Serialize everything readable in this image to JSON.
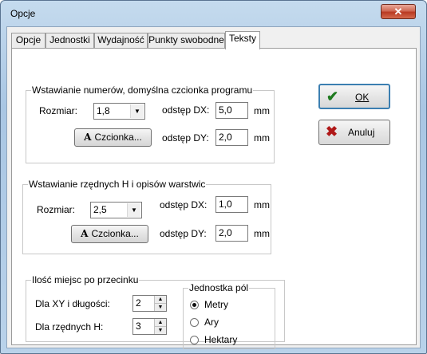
{
  "window": {
    "title": "Opcje",
    "close_glyph": "✕"
  },
  "tabs": [
    {
      "label": "Opcje"
    },
    {
      "label": "Jednostki"
    },
    {
      "label": "Wydajność"
    },
    {
      "label": "Punkty swobodne"
    },
    {
      "label": "Teksty"
    }
  ],
  "active_tab": "Teksty",
  "group_numbers": {
    "title": "Wstawianie numerów, domyślna czcionka programu",
    "size_label": "Rozmiar:",
    "size_value": "1,8",
    "font_button": "Czcionka...",
    "font_button_icon": "A",
    "dx_label": "odstęp DX:",
    "dx_value": "5,0",
    "dx_unit": "mm",
    "dy_label": "odstęp DY:",
    "dy_value": "2,0",
    "dy_unit": "mm"
  },
  "group_heights": {
    "title": "Wstawianie rzędnych H i opisów warstwic",
    "size_label": "Rozmiar:",
    "size_value": "2,5",
    "font_button": "Czcionka...",
    "font_button_icon": "A",
    "dx_label": "odstęp DX:",
    "dx_value": "1,0",
    "dx_unit": "mm",
    "dy_label": "odstęp DY:",
    "dy_value": "2,0",
    "dy_unit": "mm"
  },
  "group_decimals": {
    "title": "Ilość miejsc po przecinku",
    "xy_label": "Dla XY i długości:",
    "xy_value": "2",
    "h_label": "Dla rzędnych H:",
    "h_value": "3"
  },
  "group_area_unit": {
    "title": "Jednostka pól",
    "options": [
      {
        "label": "Metry",
        "selected": true
      },
      {
        "label": "Ary",
        "selected": false
      },
      {
        "label": "Hektary",
        "selected": false
      }
    ]
  },
  "buttons": {
    "ok_label": "OK",
    "cancel_label": "Anuluj",
    "ok_icon": "✔",
    "cancel_icon": "✖"
  },
  "colors": {
    "ok_icon": "#1f7a1f",
    "cancel_icon": "#b01818",
    "default_button_border": "#3c7fb1"
  }
}
